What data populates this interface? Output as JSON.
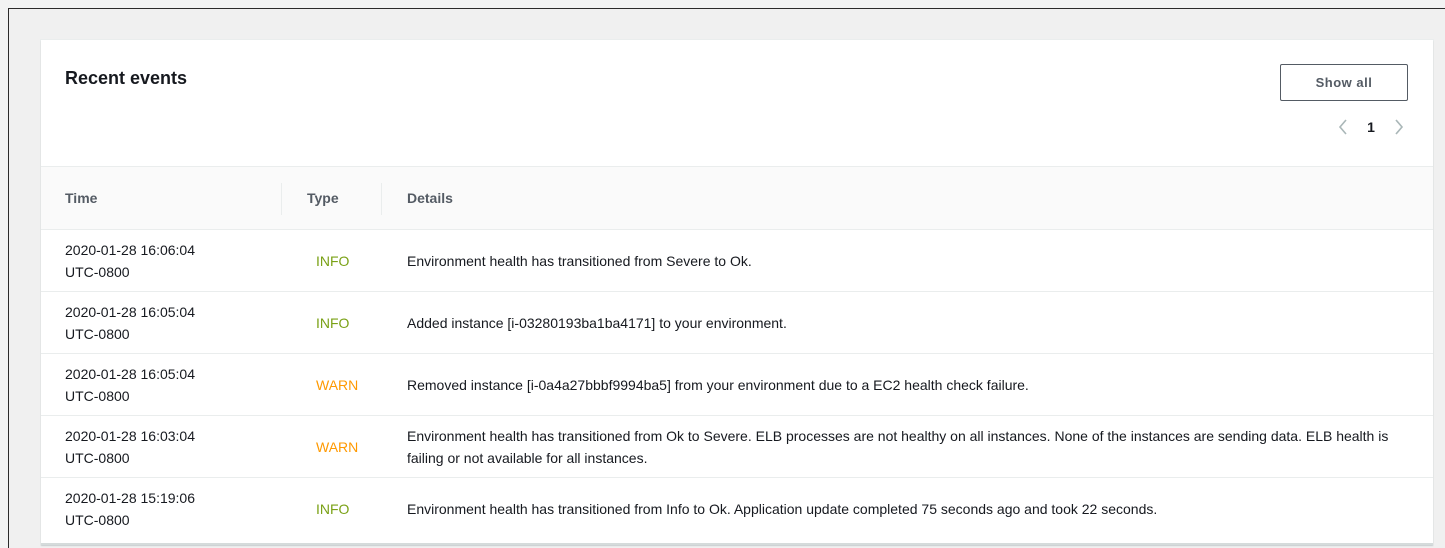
{
  "panel": {
    "title": "Recent events",
    "show_all_label": "Show all",
    "pagination": {
      "current_page": "1"
    }
  },
  "table": {
    "columns": [
      "Time",
      "Type",
      "Details"
    ],
    "rows": [
      {
        "time": "2020-01-28 16:06:04",
        "tz": "UTC-0800",
        "type": "INFO",
        "details": "Environment health has transitioned from Severe to Ok."
      },
      {
        "time": "2020-01-28 16:05:04",
        "tz": "UTC-0800",
        "type": "INFO",
        "details": "Added instance [i-03280193ba1ba4171] to your environment."
      },
      {
        "time": "2020-01-28 16:05:04",
        "tz": "UTC-0800",
        "type": "WARN",
        "details": "Removed instance [i-0a4a27bbbf9994ba5] from your environment due to a EC2 health check failure."
      },
      {
        "time": "2020-01-28 16:03:04",
        "tz": "UTC-0800",
        "type": "WARN",
        "details": "Environment health has transitioned from Ok to Severe. ELB processes are not healthy on all instances. None of the instances are sending data. ELB health is failing or not available for all instances."
      },
      {
        "time": "2020-01-28 15:19:06",
        "tz": "UTC-0800",
        "type": "INFO",
        "details": "Environment health has transitioned from Info to Ok. Application update completed 75 seconds ago and took 22 seconds."
      }
    ]
  },
  "colors": {
    "info": "#7aa116",
    "warn": "#ff9900"
  },
  "icons": {
    "prev": "chevron-left-icon",
    "next": "chevron-right-icon"
  }
}
